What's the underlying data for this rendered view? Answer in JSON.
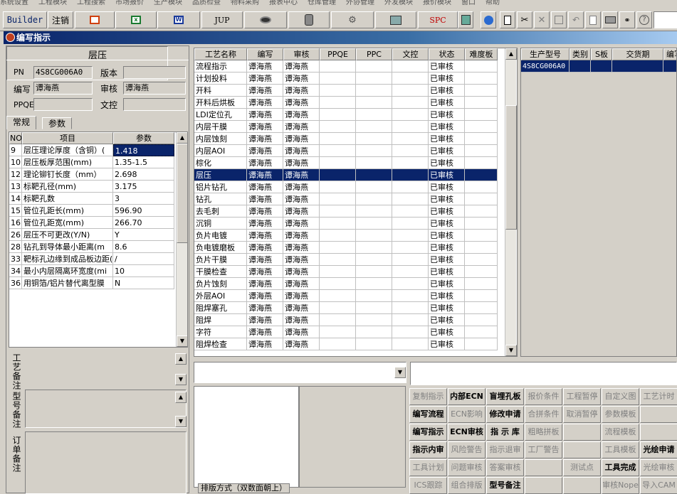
{
  "menubar": [
    "系统设置",
    "工程模块",
    "工程搜索",
    "市场报价",
    "生产模块",
    "品质检查",
    "物料采购",
    "报表中心",
    "仓库管理",
    "外协管理",
    "外发模块",
    "报价模块",
    "窗口",
    "帮助"
  ],
  "toolbar": {
    "builder": "Builder",
    "logout": "注销",
    "jup": "JUP",
    "spc": "SPC"
  },
  "window": {
    "title": "编写指示"
  },
  "left": {
    "header": "层压",
    "pn_label": "PN",
    "pn_value": "4S8CG006A0",
    "version_label": "版本",
    "version_value": "",
    "writer_label": "编写",
    "writer_value": "谭海燕",
    "reviewer_label": "审核",
    "reviewer_value": "谭海燕",
    "ppqe_label": "PPQE",
    "ppqe_value": "",
    "wenkong_label": "文控",
    "wenkong_value": "",
    "tabs": [
      "常规",
      "参数"
    ],
    "param_headers": [
      "NO",
      "项目",
      "参数"
    ],
    "params": [
      {
        "no": "9",
        "item": "层压理论厚度（含铜）(",
        "value": "1.418"
      },
      {
        "no": "10",
        "item": "层压板厚范围(mm)",
        "value": "1.35-1.5"
      },
      {
        "no": "12",
        "item": "理论铆钉长度（mm）",
        "value": "2.698"
      },
      {
        "no": "13",
        "item": "标靶孔径(mm)",
        "value": "3.175"
      },
      {
        "no": "14",
        "item": "标靶孔数",
        "value": "3"
      },
      {
        "no": "15",
        "item": "管位孔距长(mm)",
        "value": "596.90"
      },
      {
        "no": "16",
        "item": "管位孔距宽(mm)",
        "value": "266.70"
      },
      {
        "no": "26",
        "item": "层压不可更改(Y/N)",
        "value": "Y"
      },
      {
        "no": "28",
        "item": "钻孔到导体最小距离(m",
        "value": "8.6"
      },
      {
        "no": "33",
        "item": "靶标孔边缘到成品板边距(",
        "value": "/"
      },
      {
        "no": "34",
        "item": "最小内层隔离环宽度(mi",
        "value": "10"
      },
      {
        "no": "36",
        "item": "用铜箔/铝片替代离型膜",
        "value": "N"
      }
    ],
    "notes": [
      "工艺备注",
      "型号备注",
      "订单备注"
    ]
  },
  "process": {
    "headers": [
      "工艺名称",
      "编写",
      "审核",
      "PPQE",
      "PPC",
      "文控",
      "状态",
      "难度板"
    ],
    "selected_index": 9,
    "rows": [
      {
        "name": "流程指示",
        "writer": "谭海燕",
        "reviewer": "谭海燕",
        "status": "已审核"
      },
      {
        "name": "计划投料",
        "writer": "谭海燕",
        "reviewer": "谭海燕",
        "status": "已审核"
      },
      {
        "name": "开料",
        "writer": "谭海燕",
        "reviewer": "谭海燕",
        "status": "已审核"
      },
      {
        "name": "开料后烘板",
        "writer": "谭海燕",
        "reviewer": "谭海燕",
        "status": "已审核"
      },
      {
        "name": "LDI定位孔",
        "writer": "谭海燕",
        "reviewer": "谭海燕",
        "status": "已审核"
      },
      {
        "name": "内层干膜",
        "writer": "谭海燕",
        "reviewer": "谭海燕",
        "status": "已审核"
      },
      {
        "name": "内层蚀刻",
        "writer": "谭海燕",
        "reviewer": "谭海燕",
        "status": "已审核"
      },
      {
        "name": "内层AOI",
        "writer": "谭海燕",
        "reviewer": "谭海燕",
        "status": "已审核"
      },
      {
        "name": "棕化",
        "writer": "谭海燕",
        "reviewer": "谭海燕",
        "status": "已审核"
      },
      {
        "name": "层压",
        "writer": "谭海燕",
        "reviewer": "谭海燕",
        "status": "已审核"
      },
      {
        "name": "铝片钻孔",
        "writer": "谭海燕",
        "reviewer": "谭海燕",
        "status": "已审核"
      },
      {
        "name": "钻孔",
        "writer": "谭海燕",
        "reviewer": "谭海燕",
        "status": "已审核"
      },
      {
        "name": "去毛刺",
        "writer": "谭海燕",
        "reviewer": "谭海燕",
        "status": "已审核"
      },
      {
        "name": "沉铜",
        "writer": "谭海燕",
        "reviewer": "谭海燕",
        "status": "已审核"
      },
      {
        "name": "负片电镀",
        "writer": "谭海燕",
        "reviewer": "谭海燕",
        "status": "已审核"
      },
      {
        "name": "负电镀磨板",
        "writer": "谭海燕",
        "reviewer": "谭海燕",
        "status": "已审核"
      },
      {
        "name": "负片干膜",
        "writer": "谭海燕",
        "reviewer": "谭海燕",
        "status": "已审核"
      },
      {
        "name": "干膜检查",
        "writer": "谭海燕",
        "reviewer": "谭海燕",
        "status": "已审核"
      },
      {
        "name": "负片蚀刻",
        "writer": "谭海燕",
        "reviewer": "谭海燕",
        "status": "已审核"
      },
      {
        "name": "外层AOI",
        "writer": "谭海燕",
        "reviewer": "谭海燕",
        "status": "已审核"
      },
      {
        "name": "阻焊塞孔",
        "writer": "谭海燕",
        "reviewer": "谭海燕",
        "status": "已审核"
      },
      {
        "name": "阻焊",
        "writer": "谭海燕",
        "reviewer": "谭海燕",
        "status": "已审核"
      },
      {
        "name": "字符",
        "writer": "谭海燕",
        "reviewer": "谭海燕",
        "status": "已审核"
      },
      {
        "name": "阻焊检查",
        "writer": "谭海燕",
        "reviewer": "谭海燕",
        "status": "已审核"
      }
    ]
  },
  "model": {
    "headers": [
      "生产型号",
      "类别",
      "S板",
      "交货期",
      "编写"
    ],
    "rows": [
      {
        "model": "4S8CG006A0",
        "type": "",
        "s": "",
        "date": "",
        "writer": ""
      }
    ]
  },
  "layout_label": "排版方式（双数面朝上）",
  "buttons": [
    {
      "label": "复制指示",
      "enabled": false
    },
    {
      "label": "内部ECN",
      "enabled": true,
      "bold": true
    },
    {
      "label": "盲埋孔板",
      "enabled": true,
      "bold": true
    },
    {
      "label": "报价条件",
      "enabled": false
    },
    {
      "label": "工程暂停",
      "enabled": false
    },
    {
      "label": "自定义图",
      "enabled": false
    },
    {
      "label": "工艺计时",
      "enabled": false
    },
    {
      "label": "编写流程",
      "enabled": true,
      "bold": true
    },
    {
      "label": "ECN影响",
      "enabled": false
    },
    {
      "label": "修改申请",
      "enabled": true,
      "bold": true
    },
    {
      "label": "合拼条件",
      "enabled": false
    },
    {
      "label": "取消暂停",
      "enabled": false
    },
    {
      "label": "参数模板",
      "enabled": false
    },
    {
      "label": "",
      "enabled": false
    },
    {
      "label": "编写指示",
      "enabled": true,
      "bold": true
    },
    {
      "label": "ECN审核",
      "enabled": true,
      "bold": true
    },
    {
      "label": "指 示 库",
      "enabled": true,
      "bold": true
    },
    {
      "label": "粗略拼板",
      "enabled": false
    },
    {
      "label": "",
      "enabled": false
    },
    {
      "label": "流程模板",
      "enabled": false
    },
    {
      "label": "",
      "enabled": false
    },
    {
      "label": "指示内审",
      "enabled": true,
      "bold": true
    },
    {
      "label": "风险警告",
      "enabled": false
    },
    {
      "label": "指示退审",
      "enabled": false
    },
    {
      "label": "工厂警告",
      "enabled": false
    },
    {
      "label": "",
      "enabled": false
    },
    {
      "label": "工具模板",
      "enabled": false
    },
    {
      "label": "光绘申请",
      "enabled": true,
      "bold": true
    },
    {
      "label": "工具计划",
      "enabled": false
    },
    {
      "label": "问题审核",
      "enabled": false
    },
    {
      "label": "答案审核",
      "enabled": false
    },
    {
      "label": "",
      "enabled": false
    },
    {
      "label": "测试点",
      "enabled": false
    },
    {
      "label": "工具完成",
      "enabled": true,
      "bold": true
    },
    {
      "label": "光绘审核",
      "enabled": false
    },
    {
      "label": "ICS跟踪",
      "enabled": false
    },
    {
      "label": "组合排版",
      "enabled": false
    },
    {
      "label": "型号备注",
      "enabled": true,
      "bold": true
    },
    {
      "label": "",
      "enabled": false
    },
    {
      "label": "",
      "enabled": false
    },
    {
      "label": "审核Nope",
      "enabled": false
    },
    {
      "label": "导入CAM",
      "enabled": false
    }
  ],
  "colors": {
    "selection": "#0a246a",
    "title_start": "#0a246a",
    "title_end": "#a6caf0",
    "face": "#d4d0c8"
  }
}
